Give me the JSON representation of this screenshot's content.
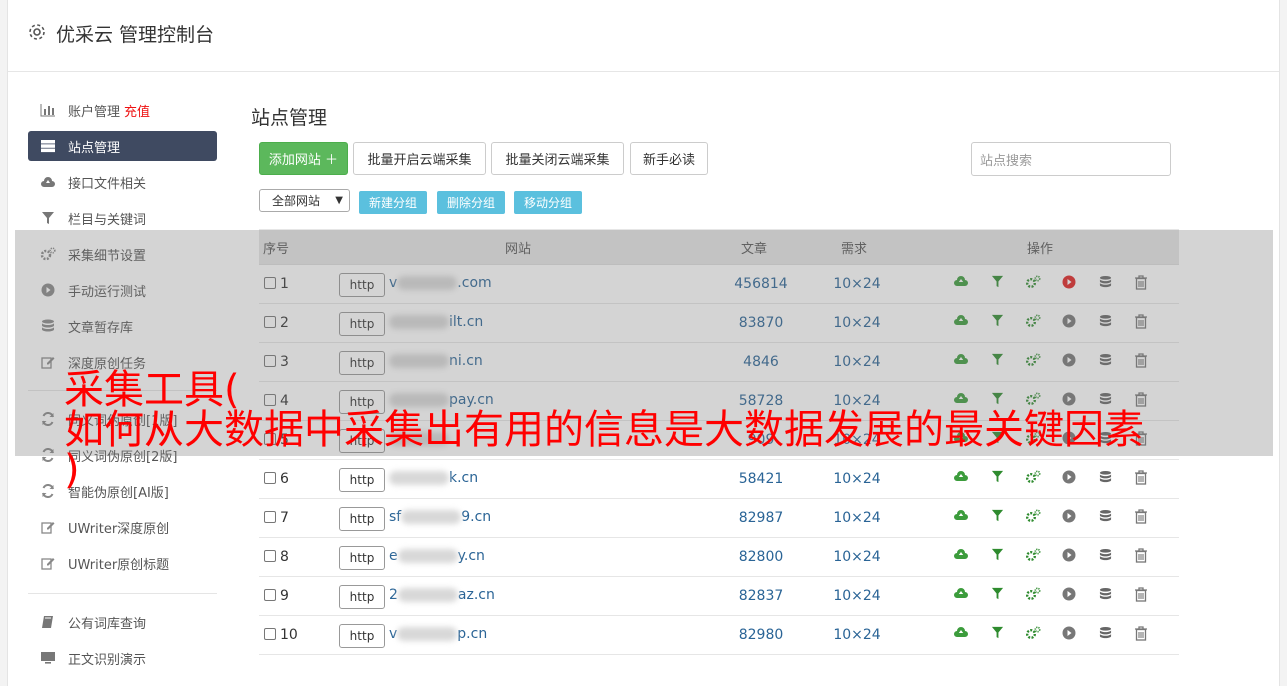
{
  "header": {
    "title": "优采云 管理控制台"
  },
  "sidebar": {
    "items": [
      {
        "label": "账户管理",
        "extra": "充值",
        "icon": "bar-chart-icon"
      },
      {
        "label": "站点管理",
        "icon": "server-icon",
        "active": true
      },
      {
        "label": "接口文件相关",
        "icon": "cloud-upload-icon"
      },
      {
        "label": "栏目与关键词",
        "icon": "filter-icon"
      },
      {
        "label": "采集细节设置",
        "icon": "gears-icon"
      },
      {
        "label": "手动运行测试",
        "icon": "play-circle-icon"
      },
      {
        "label": "文章暂存库",
        "icon": "database-icon"
      },
      {
        "label": "深度原创任务",
        "icon": "edit-icon"
      }
    ],
    "items2": [
      {
        "label": "同义词伪原创[1版]",
        "icon": "refresh-icon"
      },
      {
        "label": "同义词伪原创[2版]",
        "icon": "refresh-icon"
      },
      {
        "label": "智能伪原创[AI版]",
        "icon": "refresh-icon"
      },
      {
        "label": "UWriter深度原创",
        "icon": "edit-icon"
      },
      {
        "label": "UWriter原创标题",
        "icon": "edit-icon"
      }
    ],
    "items3": [
      {
        "label": "公有词库查询",
        "icon": "book-icon"
      },
      {
        "label": "正文识别演示",
        "icon": "monitor-icon"
      }
    ]
  },
  "main": {
    "title": "站点管理",
    "add_site": "添加网站 ＋",
    "batch_open": "批量开启云端采集",
    "batch_close": "批量关闭云端采集",
    "newbie": "新手必读",
    "search_placeholder": "站点搜索",
    "group_select": "全部网站",
    "new_group": "新建分组",
    "delete_group": "删除分组",
    "move_group": "移动分组"
  },
  "table": {
    "headers": {
      "no": "序号",
      "site": "网站",
      "articles": "文章",
      "demand": "需求",
      "ops": "操作"
    },
    "rows": [
      {
        "no": "1",
        "proto": "http",
        "prefix": "v",
        "suffix": ".com",
        "articles": "456814",
        "demand": "10×24",
        "running": true
      },
      {
        "no": "2",
        "proto": "http",
        "prefix": "",
        "suffix": "ilt.cn",
        "articles": "83870",
        "demand": "10×24",
        "running": false
      },
      {
        "no": "3",
        "proto": "http",
        "prefix": "",
        "suffix": "ni.cn",
        "articles": "4846",
        "demand": "10×24",
        "running": false
      },
      {
        "no": "4",
        "proto": "http",
        "prefix": "",
        "suffix": "pay.cn",
        "articles": "58728",
        "demand": "10×24",
        "running": false
      },
      {
        "no": "5",
        "proto": "http",
        "prefix": "",
        "suffix": "",
        "articles": "909",
        "demand": "10×24",
        "running": false
      },
      {
        "no": "6",
        "proto": "http",
        "prefix": "",
        "suffix": "k.cn",
        "articles": "58421",
        "demand": "10×24",
        "running": false
      },
      {
        "no": "7",
        "proto": "http",
        "prefix": "sf",
        "suffix": "9.cn",
        "articles": "82987",
        "demand": "10×24",
        "running": false
      },
      {
        "no": "8",
        "proto": "http",
        "prefix": "e",
        "suffix": "y.cn",
        "articles": "82800",
        "demand": "10×24",
        "running": false
      },
      {
        "no": "9",
        "proto": "http",
        "prefix": "2",
        "suffix": "az.cn",
        "articles": "82837",
        "demand": "10×24",
        "running": false
      },
      {
        "no": "10",
        "proto": "http",
        "prefix": "v",
        "suffix": "p.cn",
        "articles": "82980",
        "demand": "10×24",
        "running": false
      }
    ]
  },
  "banner": {
    "line1": "采集工具(",
    "line2": "如何从大数据中采集出有用的信息是大数据发展的最关键因素",
    "line3": ")"
  },
  "colors": {
    "sidebar_active": "#3f4a61",
    "add_button": "#5cb85c",
    "group_button": "#5bc0de",
    "link": "#2a6496",
    "banner": "#ff0000",
    "run_icon": "#e02020",
    "cloud_icon": "#3c9c3c"
  }
}
